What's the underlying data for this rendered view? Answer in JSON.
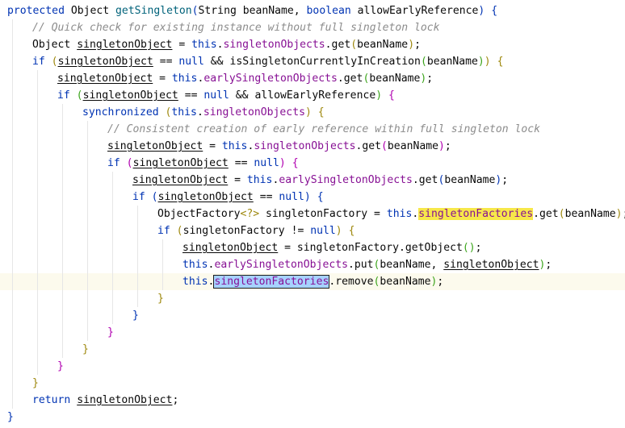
{
  "editor": {
    "language": "Java",
    "current_line_index": 16,
    "lines": [
      {
        "indent": 0,
        "tokens": [
          {
            "t": "protected",
            "c": "kw"
          },
          {
            "t": " Object "
          },
          {
            "t": "getSingleton",
            "c": "fn"
          },
          {
            "t": "(",
            "c": "p1"
          },
          {
            "t": "String beanName, "
          },
          {
            "t": "boolean",
            "c": "kw"
          },
          {
            "t": " allowEarlyReference"
          },
          {
            "t": ")",
            "c": "p1"
          },
          {
            "t": " "
          },
          {
            "t": "{",
            "c": "p1"
          }
        ]
      },
      {
        "indent": 1,
        "tokens": [
          {
            "t": "// Quick check for existing instance without full singleton lock",
            "c": "cm"
          }
        ]
      },
      {
        "indent": 1,
        "tokens": [
          {
            "t": "Object "
          },
          {
            "t": "singletonObject",
            "c": "ul"
          },
          {
            "t": " = "
          },
          {
            "t": "this",
            "c": "kw"
          },
          {
            "t": "."
          },
          {
            "t": "singletonObjects",
            "c": "fld"
          },
          {
            "t": ".get"
          },
          {
            "t": "(",
            "c": "p2"
          },
          {
            "t": "beanName"
          },
          {
            "t": ")",
            "c": "p2"
          },
          {
            "t": ";"
          }
        ]
      },
      {
        "indent": 1,
        "tokens": [
          {
            "t": "if",
            "c": "kw"
          },
          {
            "t": " "
          },
          {
            "t": "(",
            "c": "p2"
          },
          {
            "t": "singletonObject",
            "c": "ul"
          },
          {
            "t": " == "
          },
          {
            "t": "null",
            "c": "kw"
          },
          {
            "t": " && isSingletonCurrentlyInCreation"
          },
          {
            "t": "(",
            "c": "p3"
          },
          {
            "t": "beanName"
          },
          {
            "t": ")",
            "c": "p3"
          },
          {
            "t": ")",
            "c": "p2"
          },
          {
            "t": " "
          },
          {
            "t": "{",
            "c": "p2"
          }
        ]
      },
      {
        "indent": 2,
        "tokens": [
          {
            "t": "singletonObject",
            "c": "ul"
          },
          {
            "t": " = "
          },
          {
            "t": "this",
            "c": "kw"
          },
          {
            "t": "."
          },
          {
            "t": "earlySingletonObjects",
            "c": "fld"
          },
          {
            "t": ".get"
          },
          {
            "t": "(",
            "c": "p3"
          },
          {
            "t": "beanName"
          },
          {
            "t": ")",
            "c": "p3"
          },
          {
            "t": ";"
          }
        ]
      },
      {
        "indent": 2,
        "tokens": [
          {
            "t": "if",
            "c": "kw"
          },
          {
            "t": " "
          },
          {
            "t": "(",
            "c": "p3"
          },
          {
            "t": "singletonObject",
            "c": "ul"
          },
          {
            "t": " == "
          },
          {
            "t": "null",
            "c": "kw"
          },
          {
            "t": " && allowEarlyReference"
          },
          {
            "t": ")",
            "c": "p3"
          },
          {
            "t": " "
          },
          {
            "t": "{",
            "c": "p4"
          }
        ]
      },
      {
        "indent": 3,
        "tokens": [
          {
            "t": "synchronized",
            "c": "kw"
          },
          {
            "t": " "
          },
          {
            "t": "(",
            "c": "p2"
          },
          {
            "t": "this",
            "c": "kw"
          },
          {
            "t": "."
          },
          {
            "t": "singletonObjects",
            "c": "fld"
          },
          {
            "t": ")",
            "c": "p2"
          },
          {
            "t": " "
          },
          {
            "t": "{",
            "c": "p2"
          }
        ]
      },
      {
        "indent": 4,
        "tokens": [
          {
            "t": "// Consistent creation of early reference within full singleton lock",
            "c": "cm"
          }
        ]
      },
      {
        "indent": 4,
        "tokens": [
          {
            "t": "singletonObject",
            "c": "ul"
          },
          {
            "t": " = "
          },
          {
            "t": "this",
            "c": "kw"
          },
          {
            "t": "."
          },
          {
            "t": "singletonObjects",
            "c": "fld"
          },
          {
            "t": ".get"
          },
          {
            "t": "(",
            "c": "p4"
          },
          {
            "t": "beanName"
          },
          {
            "t": ")",
            "c": "p4"
          },
          {
            "t": ";"
          }
        ]
      },
      {
        "indent": 4,
        "tokens": [
          {
            "t": "if",
            "c": "kw"
          },
          {
            "t": " "
          },
          {
            "t": "(",
            "c": "p4"
          },
          {
            "t": "singletonObject",
            "c": "ul"
          },
          {
            "t": " == "
          },
          {
            "t": "null",
            "c": "kw"
          },
          {
            "t": ")",
            "c": "p4"
          },
          {
            "t": " "
          },
          {
            "t": "{",
            "c": "p4"
          }
        ]
      },
      {
        "indent": 5,
        "tokens": [
          {
            "t": "singletonObject",
            "c": "ul"
          },
          {
            "t": " = "
          },
          {
            "t": "this",
            "c": "kw"
          },
          {
            "t": "."
          },
          {
            "t": "earlySingletonObjects",
            "c": "fld"
          },
          {
            "t": ".get"
          },
          {
            "t": "(",
            "c": "p5"
          },
          {
            "t": "beanName"
          },
          {
            "t": ")",
            "c": "p5"
          },
          {
            "t": ";"
          }
        ]
      },
      {
        "indent": 5,
        "tokens": [
          {
            "t": "if",
            "c": "kw"
          },
          {
            "t": " "
          },
          {
            "t": "(",
            "c": "p5"
          },
          {
            "t": "singletonObject",
            "c": "ul"
          },
          {
            "t": " == "
          },
          {
            "t": "null",
            "c": "kw"
          },
          {
            "t": ")",
            "c": "p5"
          },
          {
            "t": " "
          },
          {
            "t": "{",
            "c": "p5"
          }
        ]
      },
      {
        "indent": 6,
        "tokens": [
          {
            "t": "ObjectFactory"
          },
          {
            "t": "<?>",
            "c": "p2"
          },
          {
            "t": " singletonFactory = "
          },
          {
            "t": "this",
            "c": "kw"
          },
          {
            "t": "."
          },
          {
            "t": "singletonFactories",
            "c": "fld hl-y"
          },
          {
            "t": ".get"
          },
          {
            "t": "(",
            "c": "p2"
          },
          {
            "t": "beanName"
          },
          {
            "t": ")",
            "c": "p2"
          },
          {
            "t": ";"
          }
        ]
      },
      {
        "indent": 6,
        "tokens": [
          {
            "t": "if",
            "c": "kw"
          },
          {
            "t": " "
          },
          {
            "t": "(",
            "c": "p2"
          },
          {
            "t": "singletonFactory != "
          },
          {
            "t": "null",
            "c": "kw"
          },
          {
            "t": ")",
            "c": "p2"
          },
          {
            "t": " "
          },
          {
            "t": "{",
            "c": "p2"
          }
        ]
      },
      {
        "indent": 7,
        "tokens": [
          {
            "t": "singletonObject",
            "c": "ul"
          },
          {
            "t": " = singletonFactory.getObject"
          },
          {
            "t": "(",
            "c": "p3"
          },
          {
            "t": ")",
            "c": "p3"
          },
          {
            "t": ";"
          }
        ]
      },
      {
        "indent": 7,
        "tokens": [
          {
            "t": "this",
            "c": "kw"
          },
          {
            "t": "."
          },
          {
            "t": "earlySingletonObjects",
            "c": "fld"
          },
          {
            "t": ".put"
          },
          {
            "t": "(",
            "c": "p3"
          },
          {
            "t": "beanName, "
          },
          {
            "t": "singletonObject",
            "c": "ul"
          },
          {
            "t": ")",
            "c": "p3"
          },
          {
            "t": ";"
          }
        ]
      },
      {
        "indent": 7,
        "tokens": [
          {
            "t": "this",
            "c": "kw"
          },
          {
            "t": "."
          },
          {
            "t": "singletonFactories",
            "c": "fld hl-b"
          },
          {
            "t": ".remove"
          },
          {
            "t": "(",
            "c": "p3"
          },
          {
            "t": "beanName"
          },
          {
            "t": ")",
            "c": "p3"
          },
          {
            "t": ";"
          }
        ]
      },
      {
        "indent": 6,
        "tokens": [
          {
            "t": "}",
            "c": "p2"
          }
        ]
      },
      {
        "indent": 5,
        "tokens": [
          {
            "t": "}",
            "c": "p5"
          }
        ]
      },
      {
        "indent": 4,
        "tokens": [
          {
            "t": "}",
            "c": "p4"
          }
        ]
      },
      {
        "indent": 3,
        "tokens": [
          {
            "t": "}",
            "c": "p2"
          }
        ]
      },
      {
        "indent": 2,
        "tokens": [
          {
            "t": "}",
            "c": "p4"
          }
        ]
      },
      {
        "indent": 1,
        "tokens": [
          {
            "t": "}",
            "c": "p2"
          }
        ]
      },
      {
        "indent": 1,
        "tokens": [
          {
            "t": "return",
            "c": "kw"
          },
          {
            "t": " "
          },
          {
            "t": "singletonObject",
            "c": "ul"
          },
          {
            "t": ";"
          }
        ]
      },
      {
        "indent": 0,
        "tokens": [
          {
            "t": "}",
            "c": "p1"
          }
        ]
      }
    ]
  },
  "colors": {
    "background": "#ffffff",
    "current_line_background": "#fcfaed",
    "keyword": "#0033b3",
    "method_name": "#00627a",
    "field": "#871094",
    "comment": "#8c8c8c",
    "search_highlight": "#f7e84a",
    "selection_highlight": "#a6d2ff"
  }
}
